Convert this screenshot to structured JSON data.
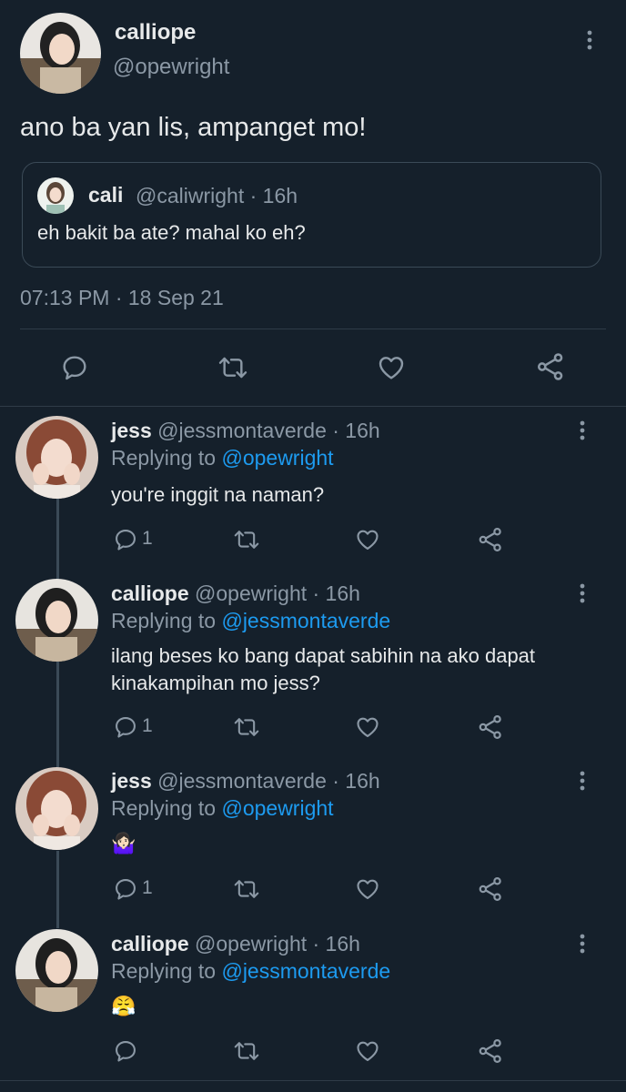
{
  "colors": {
    "background": "#15202b",
    "text": "#e7e9ea",
    "muted": "#8b98a5",
    "link": "#1d9bf0"
  },
  "main_tweet": {
    "name": "calliope",
    "handle": "@opewright",
    "text": "ano ba yan lis, ampanget mo!",
    "quote": {
      "name": "cali",
      "meta": "@caliwright · 16h",
      "text": "eh bakit ba ate? mahal ko eh?"
    },
    "timestamp": "07:13 PM · 18 Sep 21",
    "actions": [
      "reply-icon",
      "retweet-icon",
      "like-icon",
      "share-icon"
    ]
  },
  "replies": [
    {
      "name": "jess",
      "meta": "@jessmontaverde · 16h",
      "replying_label": "Replying to",
      "replying_to": "@opewright",
      "text": "you're inggit na naman?",
      "reply_count": "1"
    },
    {
      "name": "calliope",
      "meta": "@opewright · 16h",
      "replying_label": "Replying to",
      "replying_to": "@jessmontaverde",
      "text_lines": [
        "ilang beses ko bang dapat sabihin na ako dapat",
        "kinakampihan mo jess?"
      ],
      "reply_count": "1"
    },
    {
      "name": "jess",
      "meta": "@jessmontaverde · 16h",
      "replying_label": "Replying to",
      "replying_to": "@opewright",
      "text": "🤷🏻‍♀️",
      "reply_count": "1"
    },
    {
      "name": "calliope",
      "meta": "@opewright · 16h",
      "replying_label": "Replying to",
      "replying_to": "@jessmontaverde",
      "text": "😤",
      "reply_count": ""
    }
  ]
}
